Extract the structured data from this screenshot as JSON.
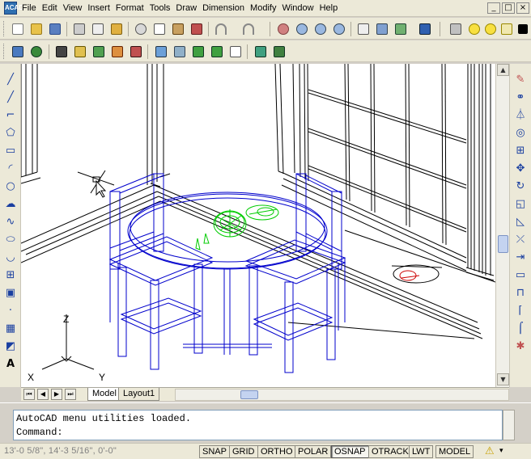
{
  "app": {
    "icon_label": "ACAD"
  },
  "menu": [
    "File",
    "Edit",
    "View",
    "Insert",
    "Format",
    "Tools",
    "Draw",
    "Dimension",
    "Modify",
    "Window",
    "Help"
  ],
  "window_controls": [
    "_",
    "□",
    "×"
  ],
  "layout_tabs": {
    "model": "Model",
    "layout1": "Layout1"
  },
  "ucs": {
    "x_label": "X",
    "y_label": "Y",
    "z_label": "Z"
  },
  "command": {
    "history": "AutoCAD menu utilities loaded.",
    "prompt": "Command:"
  },
  "status": {
    "coords": "13'-0 5/8\", 14'-3 5/16\", 0'-0\"",
    "buttons": [
      "SNAP",
      "GRID",
      "ORTHO",
      "POLAR",
      "OSNAP",
      "OTRACK",
      "LWT",
      "MODEL"
    ]
  },
  "drawing": {
    "colors": {
      "blue": "#0000cc",
      "green": "#00cc00",
      "red": "#cc0000",
      "black": "#000000"
    }
  }
}
